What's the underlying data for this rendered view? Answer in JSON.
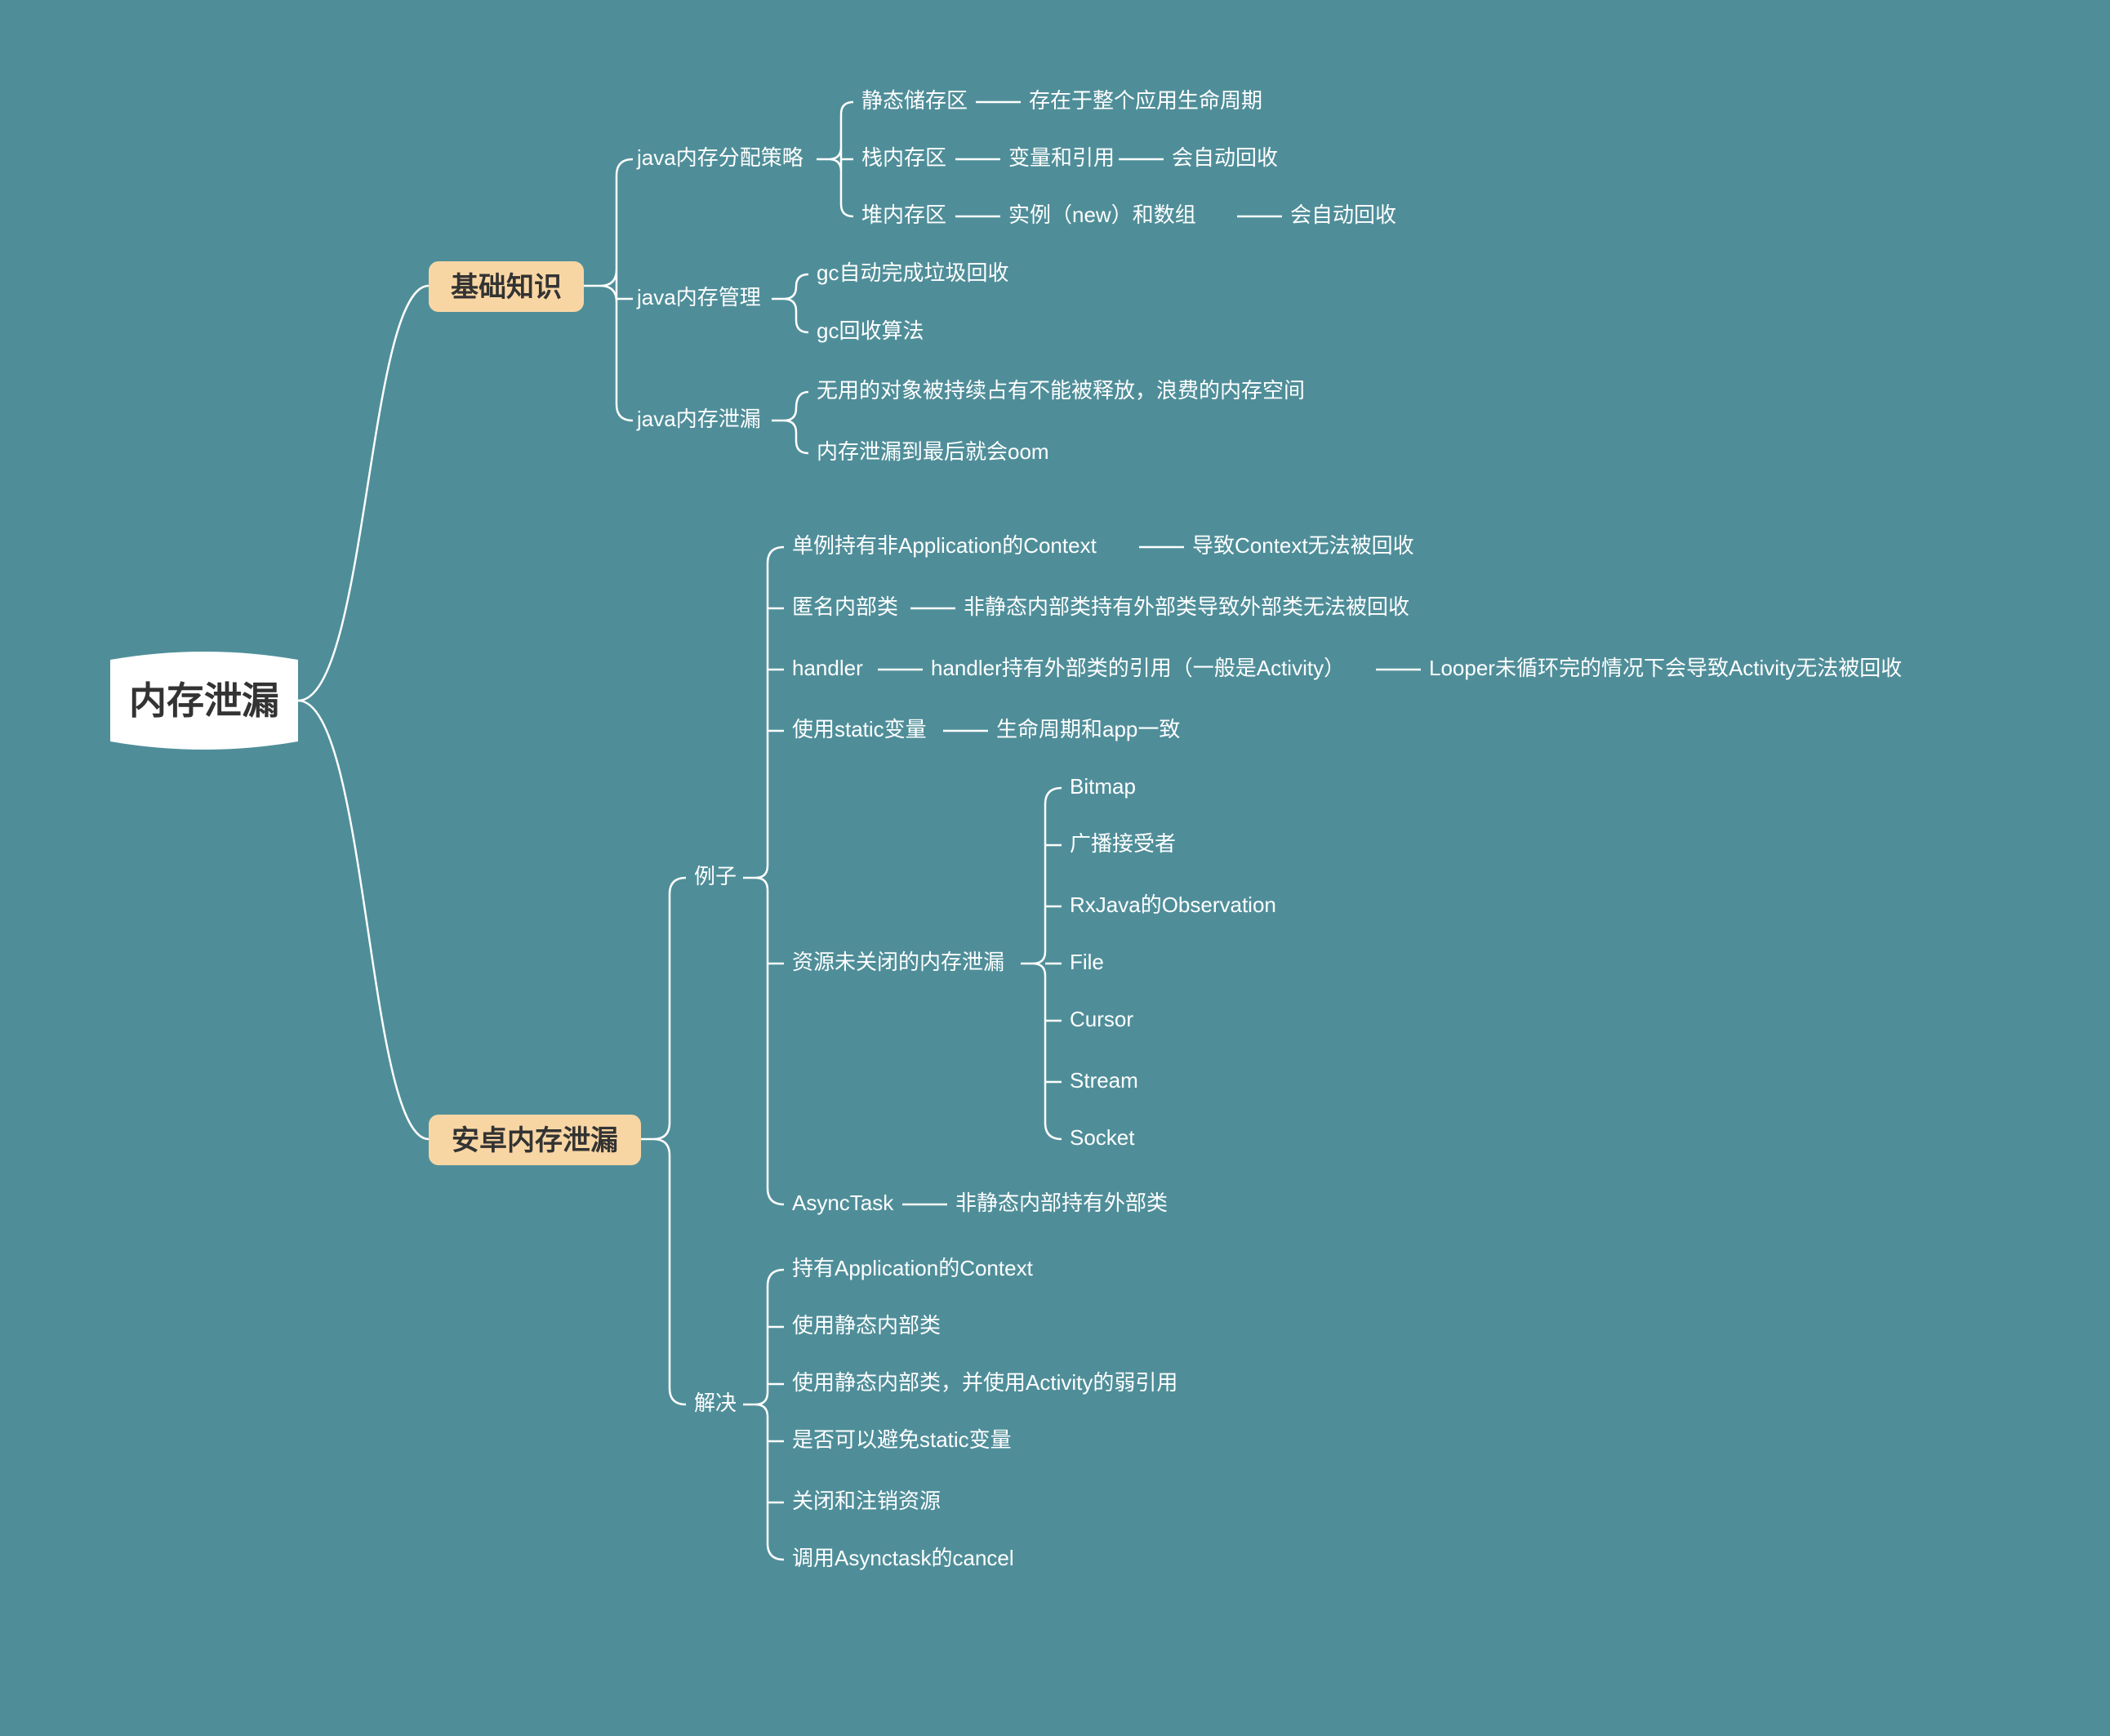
{
  "root": "内存泄漏",
  "cat": {
    "basic": "基础知识",
    "android": "安卓内存泄漏"
  },
  "basic": {
    "alloc": {
      "label": "java内存分配策略",
      "static": "静态储存区",
      "staticNote": "存在于整个应用生命周期",
      "stack": "栈内存区",
      "stackNote1": "变量和引用",
      "stackNote2": "会自动回收",
      "heap": "堆内存区",
      "heapNote1": "实例（new）和数组",
      "heapNote2": "会自动回收"
    },
    "mgmt": {
      "label": "java内存管理",
      "gc1": "gc自动完成垃圾回收",
      "gc2": "gc回收算法"
    },
    "leak": {
      "label": "java内存泄漏",
      "note1": "无用的对象被持续占有不能被释放，浪费的内存空间",
      "note2": "内存泄漏到最后就会oom"
    }
  },
  "android": {
    "examples": {
      "label": "例子",
      "singleton": "单例持有非Application的Context",
      "singletonNote": "导致Context无法被回收",
      "anonymous": "匿名内部类",
      "anonymousNote": "非静态内部类持有外部类导致外部类无法被回收",
      "handler": "handler",
      "handlerNote1": "handler持有外部类的引用（一般是Activity）",
      "handlerNote2": "Looper未循环完的情况下会导致Activity无法被回收",
      "staticVar": "使用static变量",
      "staticVarNote": "生命周期和app一致",
      "resource": "资源未关闭的内存泄漏",
      "resItems": {
        "bitmap": "Bitmap",
        "broadcast": "广播接受者",
        "rx": "RxJava的Observation",
        "file": "File",
        "cursor": "Cursor",
        "stream": "Stream",
        "socket": "Socket"
      },
      "asyncTask": "AsyncTask",
      "asyncTaskNote": "非静态内部持有外部类"
    },
    "solutions": {
      "label": "解决",
      "s1": "持有Application的Context",
      "s2": "使用静态内部类",
      "s3": "使用静态内部类，并使用Activity的弱引用",
      "s4": "是否可以避免static变量",
      "s5": "关闭和注销资源",
      "s6": "调用Asynctask的cancel"
    }
  }
}
